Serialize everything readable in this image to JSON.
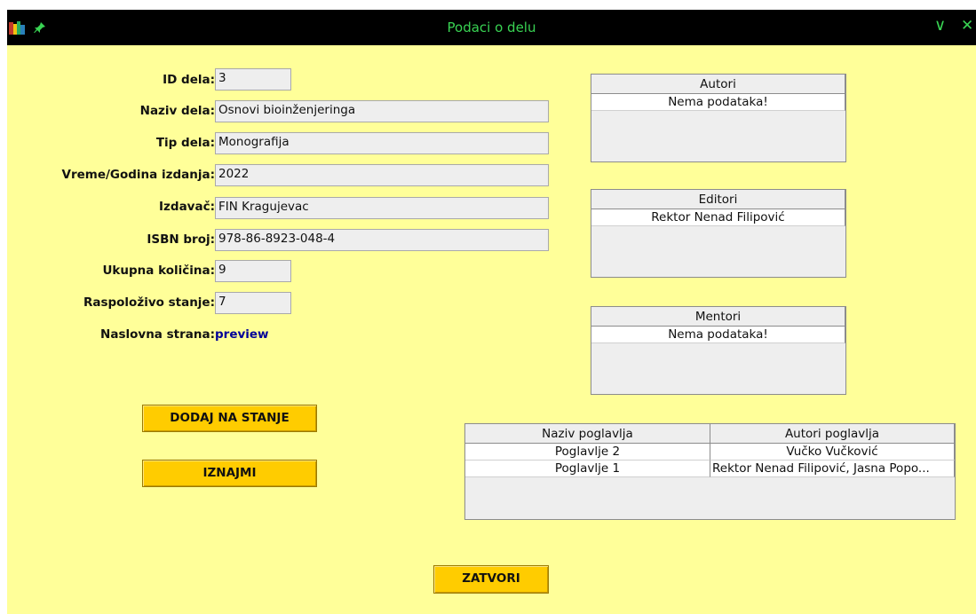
{
  "window": {
    "title": "Podaci o delu",
    "controls": {
      "minimize_glyph": "∨",
      "close_glyph": "✕"
    },
    "icons": [
      "books-app-icon",
      "pin-icon"
    ]
  },
  "form": {
    "id_label": "ID dela:",
    "id_value": "3",
    "naziv_label": "Naziv dela:",
    "naziv_value": "Osnovi bioinženjeringa",
    "tip_label": "Tip dela:",
    "tip_value": "Monografija",
    "vreme_label": "Vreme/Godina izdanja:",
    "vreme_value": "2022",
    "izdavac_label": "Izdavač:",
    "izdavac_value": "FIN Kragujevac",
    "isbn_label": "ISBN broj:",
    "isbn_value": "978-86-8923-048-4",
    "ukupna_label": "Ukupna količina:",
    "ukupna_value": "9",
    "raspolozivo_label": "Raspoloživo stanje:",
    "raspolozivo_value": "7",
    "naslovna_label": "Naslovna strana:",
    "naslovna_link": "preview"
  },
  "buttons": {
    "dodaj": "DODAJ NA STANJE",
    "iznajmi": "IZNAJMI",
    "zatvori": "ZATVORI"
  },
  "tables": {
    "autori": {
      "header": "Autori",
      "rows": [
        "Nema podataka!"
      ]
    },
    "editori": {
      "header": "Editori",
      "rows": [
        "Rektor Nenad Filipović"
      ]
    },
    "mentori": {
      "header": "Mentori",
      "rows": [
        "Nema podataka!"
      ]
    },
    "poglavlja": {
      "headers": [
        "Naziv poglavlja",
        "Autori poglavlja"
      ],
      "rows": [
        [
          "Poglavlje 2",
          "Vučko Vučković"
        ],
        [
          "Poglavlje 1",
          "Rektor Nenad Filipović, Jasna Popo..."
        ]
      ]
    }
  },
  "colors": {
    "background": "#ffff99",
    "titlebar": "#000000",
    "title_text": "#39d353",
    "button": "#ffcc00",
    "link": "#000099"
  }
}
